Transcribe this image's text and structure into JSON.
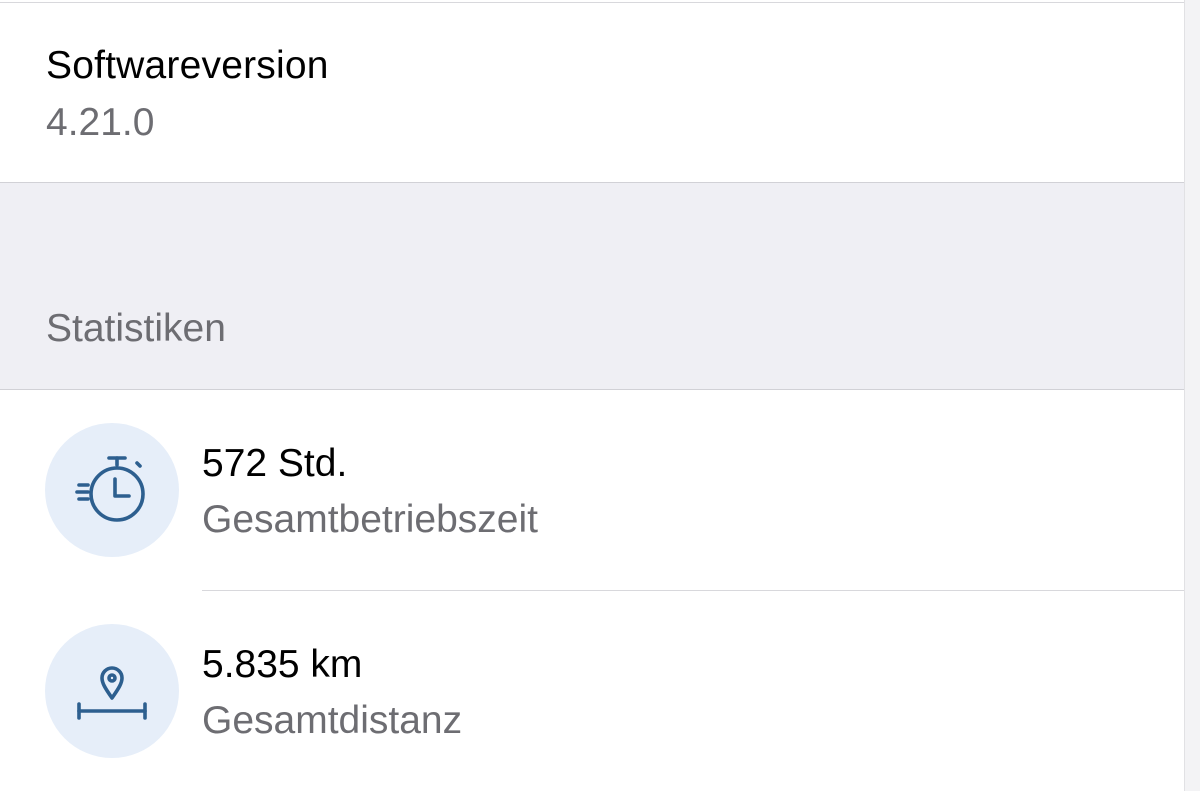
{
  "software": {
    "title": "Softwareversion",
    "value": "4.21.0"
  },
  "statistics": {
    "header": "Statistiken",
    "items": [
      {
        "icon": "stopwatch-icon",
        "value": "572 Std.",
        "label": "Gesamtbetriebszeit"
      },
      {
        "icon": "location-distance-icon",
        "value": "5.835 km",
        "label": "Gesamtdistanz"
      }
    ]
  },
  "colors": {
    "icon_stroke": "#2d5f8f",
    "icon_background": "#e6eef9",
    "section_background": "#efeff4",
    "secondary_text": "#6d6d72"
  }
}
